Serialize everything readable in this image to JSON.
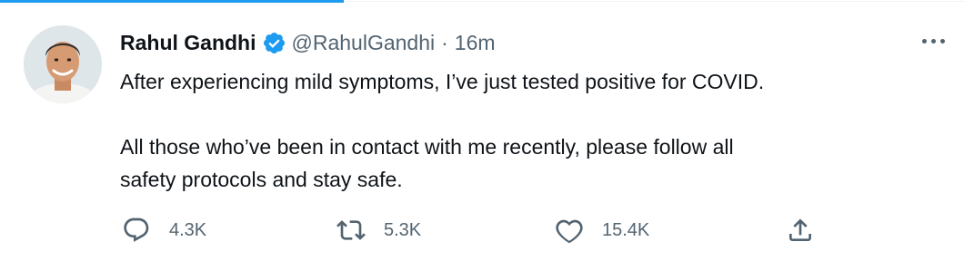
{
  "tweet": {
    "author": {
      "display_name": "Rahul Gandhi",
      "handle": "@RahulGandhi",
      "verified": true,
      "avatar_icon": "profile-photo"
    },
    "separator": "·",
    "timestamp": "16m",
    "text": {
      "line1": "After experiencing mild symptoms, I’ve just tested positive for COVID.",
      "line2": "All those who’ve been in contact with me recently, please follow all",
      "line3": "safety protocols and stay safe."
    },
    "actions": {
      "reply": {
        "icon": "reply-icon",
        "count": "4.3K"
      },
      "retweet": {
        "icon": "retweet-icon",
        "count": "5.3K"
      },
      "like": {
        "icon": "heart-icon",
        "count": "15.4K"
      },
      "share": {
        "icon": "share-icon"
      }
    },
    "more_icon": "more-options-icon"
  },
  "colors": {
    "primary_text": "#0f1419",
    "secondary_text": "#536471",
    "verified_blue": "#1d9bf0",
    "accent_line": "#1d9bf0"
  }
}
